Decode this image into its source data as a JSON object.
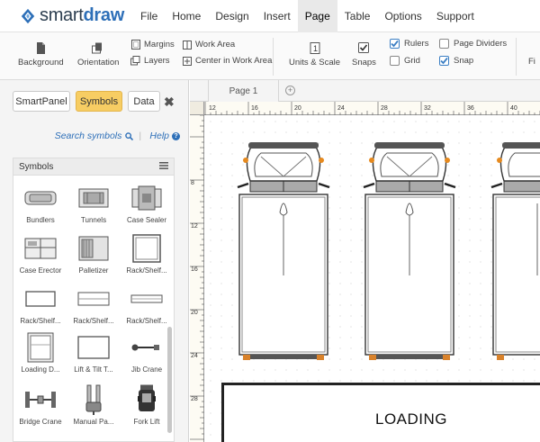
{
  "app": {
    "logo_text_a": "smart",
    "logo_text_b": "draw",
    "brand_color": "#2d6fb8"
  },
  "menu": {
    "items": [
      {
        "label": "File"
      },
      {
        "label": "Home"
      },
      {
        "label": "Design"
      },
      {
        "label": "Insert"
      },
      {
        "label": "Page",
        "active": true
      },
      {
        "label": "Table"
      },
      {
        "label": "Options"
      },
      {
        "label": "Support"
      }
    ]
  },
  "ribbon": {
    "background": "Background",
    "orientation": "Orientation",
    "margins": "Margins",
    "layers": "Layers",
    "work_area": "Work Area",
    "center_work_area": "Center in Work Area",
    "units_scale": "Units & Scale",
    "snaps": "Snaps",
    "rulers": {
      "label": "Rulers",
      "checked": true
    },
    "grid": {
      "label": "Grid",
      "checked": false
    },
    "page_dividers": {
      "label": "Page Dividers",
      "checked": false
    },
    "snap": {
      "label": "Snap",
      "checked": true
    },
    "cut_off": "Fi"
  },
  "panel": {
    "tabs": [
      {
        "label": "SmartPanel"
      },
      {
        "label": "Symbols",
        "active": true
      },
      {
        "label": "Data"
      }
    ],
    "close": "✖",
    "search_link": "Search symbols",
    "help_link": "Help",
    "library_title": "Symbols",
    "symbols": [
      {
        "label": "Bundlers",
        "icon": "bundler-icon"
      },
      {
        "label": "Tunnels",
        "icon": "tunnel-icon"
      },
      {
        "label": "Case Sealer",
        "icon": "case-sealer-icon"
      },
      {
        "label": "Case Erector",
        "icon": "case-erector-icon"
      },
      {
        "label": "Palletizer",
        "icon": "palletizer-icon"
      },
      {
        "label": "Rack/Shelf...",
        "icon": "rack-shelf-icon"
      },
      {
        "label": "Rack/Shelf...",
        "icon": "rack-shelf-icon"
      },
      {
        "label": "Rack/Shelf...",
        "icon": "rack-shelf-icon"
      },
      {
        "label": "Rack/Shelf...",
        "icon": "rack-shelf-icon"
      },
      {
        "label": "Loading D...",
        "icon": "loading-dock-icon"
      },
      {
        "label": "Lift & Tilt T...",
        "icon": "lift-tilt-icon"
      },
      {
        "label": "Jib Crane",
        "icon": "jib-crane-icon"
      },
      {
        "label": "Bridge Crane",
        "icon": "bridge-crane-icon"
      },
      {
        "label": "Manual Pa...",
        "icon": "manual-pallet-icon"
      },
      {
        "label": "Fork Lift",
        "icon": "forklift-icon"
      }
    ]
  },
  "page_tabs": {
    "current": "Page 1",
    "add": "+"
  },
  "rulers": {
    "top_labels": [
      "12",
      "16",
      "20",
      "24",
      "28",
      "32",
      "36",
      "40"
    ],
    "left_labels": [
      "8",
      "12",
      "16",
      "20",
      "24",
      "28"
    ]
  },
  "canvas": {
    "loading_label": "LOADING"
  }
}
